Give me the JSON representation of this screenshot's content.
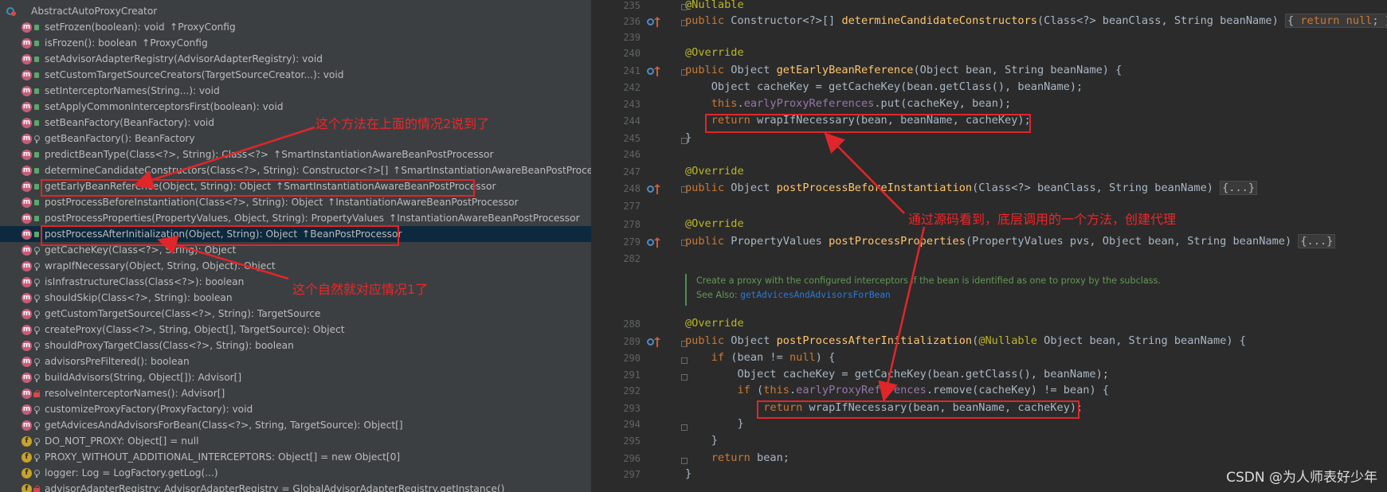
{
  "structure": {
    "root_label": "AbstractAutoProxyCreator",
    "members": [
      {
        "kind": "m",
        "vis": "public",
        "sig": "setFrozen(boolean): void",
        "inh": "↑ProxyConfig"
      },
      {
        "kind": "m",
        "vis": "public",
        "sig": "isFrozen(): boolean",
        "inh": "↑ProxyConfig"
      },
      {
        "kind": "m",
        "vis": "public",
        "sig": "setAdvisorAdapterRegistry(AdvisorAdapterRegistry): void",
        "inh": ""
      },
      {
        "kind": "m",
        "vis": "public",
        "sig": "setCustomTargetSourceCreators(TargetSourceCreator...): void",
        "inh": ""
      },
      {
        "kind": "m",
        "vis": "public",
        "sig": "setInterceptorNames(String...): void",
        "inh": ""
      },
      {
        "kind": "m",
        "vis": "public",
        "sig": "setApplyCommonInterceptorsFirst(boolean): void",
        "inh": ""
      },
      {
        "kind": "m",
        "vis": "public",
        "sig": "setBeanFactory(BeanFactory): void",
        "inh": ""
      },
      {
        "kind": "m",
        "vis": "protected",
        "sig": "getBeanFactory(): BeanFactory",
        "inh": ""
      },
      {
        "kind": "m",
        "vis": "public",
        "sig": "predictBeanType(Class<?>, String): Class<?>",
        "inh": "↑SmartInstantiationAwareBeanPostProcessor"
      },
      {
        "kind": "m",
        "vis": "public",
        "sig": "determineCandidateConstructors(Class<?>, String): Constructor<?>[]",
        "inh": "↑SmartInstantiationAwareBeanPostProcessor"
      },
      {
        "kind": "m",
        "vis": "public",
        "sig": "getEarlyBeanReference(Object, String): Object",
        "inh": "↑SmartInstantiationAwareBeanPostProcessor"
      },
      {
        "kind": "m",
        "vis": "public",
        "sig": "postProcessBeforeInstantiation(Class<?>, String): Object",
        "inh": "↑InstantiationAwareBeanPostProcessor"
      },
      {
        "kind": "m",
        "vis": "public",
        "sig": "postProcessProperties(PropertyValues, Object, String): PropertyValues",
        "inh": "↑InstantiationAwareBeanPostProcessor"
      },
      {
        "kind": "m",
        "vis": "public",
        "sig": "postProcessAfterInitialization(Object, String): Object",
        "inh": "↑BeanPostProcessor"
      },
      {
        "kind": "m",
        "vis": "protected",
        "sig": "getCacheKey(Class<?>, String): Object",
        "inh": ""
      },
      {
        "kind": "m",
        "vis": "protected",
        "sig": "wrapIfNecessary(Object, String, Object): Object",
        "inh": ""
      },
      {
        "kind": "m",
        "vis": "protected",
        "sig": "isInfrastructureClass(Class<?>): boolean",
        "inh": ""
      },
      {
        "kind": "m",
        "vis": "protected",
        "sig": "shouldSkip(Class<?>, String): boolean",
        "inh": ""
      },
      {
        "kind": "m",
        "vis": "protected",
        "sig": "getCustomTargetSource(Class<?>, String): TargetSource",
        "inh": ""
      },
      {
        "kind": "m",
        "vis": "protected",
        "sig": "createProxy(Class<?>, String, Object[], TargetSource): Object",
        "inh": ""
      },
      {
        "kind": "m",
        "vis": "protected",
        "sig": "shouldProxyTargetClass(Class<?>, String): boolean",
        "inh": ""
      },
      {
        "kind": "m",
        "vis": "protected",
        "sig": "advisorsPreFiltered(): boolean",
        "inh": ""
      },
      {
        "kind": "m",
        "vis": "protected",
        "sig": "buildAdvisors(String, Object[]): Advisor[]",
        "inh": ""
      },
      {
        "kind": "m",
        "vis": "private",
        "sig": "resolveInterceptorNames(): Advisor[]",
        "inh": ""
      },
      {
        "kind": "m",
        "vis": "protected",
        "sig": "customizeProxyFactory(ProxyFactory): void",
        "inh": ""
      },
      {
        "kind": "m",
        "vis": "protected",
        "sig": "getAdvicesAndAdvisorsForBean(Class<?>, String, TargetSource): Object[]",
        "inh": ""
      },
      {
        "kind": "f",
        "vis": "protected",
        "sig": "DO_NOT_PROXY: Object[] = null",
        "inh": ""
      },
      {
        "kind": "f",
        "vis": "protected",
        "sig": "PROXY_WITHOUT_ADDITIONAL_INTERCEPTORS: Object[] = new Object[0]",
        "inh": ""
      },
      {
        "kind": "f",
        "vis": "protected",
        "sig": "logger: Log = LogFactory.getLog(...)",
        "inh": ""
      },
      {
        "kind": "f",
        "vis": "private",
        "sig": "advisorAdapterRegistry: AdvisorAdapterRegistry = GlobalAdvisorAdapterRegistry.getInstance()",
        "inh": ""
      }
    ]
  },
  "annotations": {
    "case2": "这个方法在上面的情况2说到了",
    "case1": "这个自然就对应情况1了",
    "source": "通过源码看到，底层调用的一个方法，创建代理"
  },
  "editor": {
    "lines": [
      {
        "num": "235",
        "html": "<span class=\"ann\">@Nullable</span>"
      },
      {
        "num": "236",
        "html": "<span class=\"kw\">public</span> Constructor&lt;?&gt;[] <span class=\"fn\">determineCandidateConstructors</span>(Class&lt;?&gt; beanClass, String beanName) <span class=\"fold\">{ <span class=\"kw\">return null</span>; }</span>"
      },
      {
        "num": "239",
        "html": ""
      },
      {
        "num": "240",
        "html": "<span class=\"ann\">@Override</span>"
      },
      {
        "num": "241",
        "html": "<span class=\"kw\">public</span> Object <span class=\"fn\">getEarlyBeanReference</span>(Object bean, String beanName) {"
      },
      {
        "num": "242",
        "html": "    Object cacheKey = getCacheKey(bean.getClass(), beanName);"
      },
      {
        "num": "243",
        "html": "    <span class=\"kw\">this</span>.<span class=\"fld\">earlyProxyReferences</span>.put(cacheKey, bean);"
      },
      {
        "num": "244",
        "html": "    <span class=\"kw\">return</span> wrapIfNecessary(bean, beanName, cacheKey);"
      },
      {
        "num": "245",
        "html": "}"
      },
      {
        "num": "246",
        "html": ""
      },
      {
        "num": "247",
        "html": "<span class=\"ann\">@Override</span>"
      },
      {
        "num": "248",
        "html": "<span class=\"kw\">public</span> Object <span class=\"fn\">postProcessBeforeInstantiation</span>(Class&lt;?&gt; beanClass, String beanName) <span class=\"fold\">{...}</span>"
      },
      {
        "num": "277",
        "html": ""
      },
      {
        "num": "278",
        "html": "<span class=\"ann\">@Override</span>"
      },
      {
        "num": "279",
        "html": "<span class=\"kw\">public</span> PropertyValues <span class=\"fn\">postProcessProperties</span>(PropertyValues pvs, Object bean, String beanName) <span class=\"fold\">{...}</span>"
      },
      {
        "num": "282",
        "html": ""
      },
      {
        "num": "288",
        "html": "<span class=\"ann\">@Override</span>"
      },
      {
        "num": "289",
        "html": "<span class=\"kw\">public</span> Object <span class=\"fn\">postProcessAfterInitialization</span>(<span class=\"ann\">@Nullable</span> Object bean, String beanName) {"
      },
      {
        "num": "290",
        "html": "    <span class=\"kw\">if</span> (bean != <span class=\"kw\">null</span>) {"
      },
      {
        "num": "291",
        "html": "        Object cacheKey = getCacheKey(bean.getClass(), beanName);"
      },
      {
        "num": "292",
        "html": "        <span class=\"kw\">if</span> (<span class=\"kw\">this</span>.<span class=\"fld\">earlyProxyReferences</span>.remove(cacheKey) != bean) {"
      },
      {
        "num": "293",
        "html": "            <span class=\"kw\">return</span> wrapIfNecessary(bean, beanName, cacheKey);"
      },
      {
        "num": "294",
        "html": "        }"
      },
      {
        "num": "295",
        "html": "    }"
      },
      {
        "num": "296",
        "html": "    <span class=\"kw\">return</span> bean;"
      },
      {
        "num": "297",
        "html": "}"
      }
    ],
    "javadoc_text": "Create a proxy with the configured interceptors if the bean is identified as one to proxy by the subclass.",
    "javadoc_see_label": "See Also:",
    "javadoc_see_link": "getAdvicesAndAdvisorsForBean"
  },
  "watermark": "CSDN @为人师表好少年"
}
